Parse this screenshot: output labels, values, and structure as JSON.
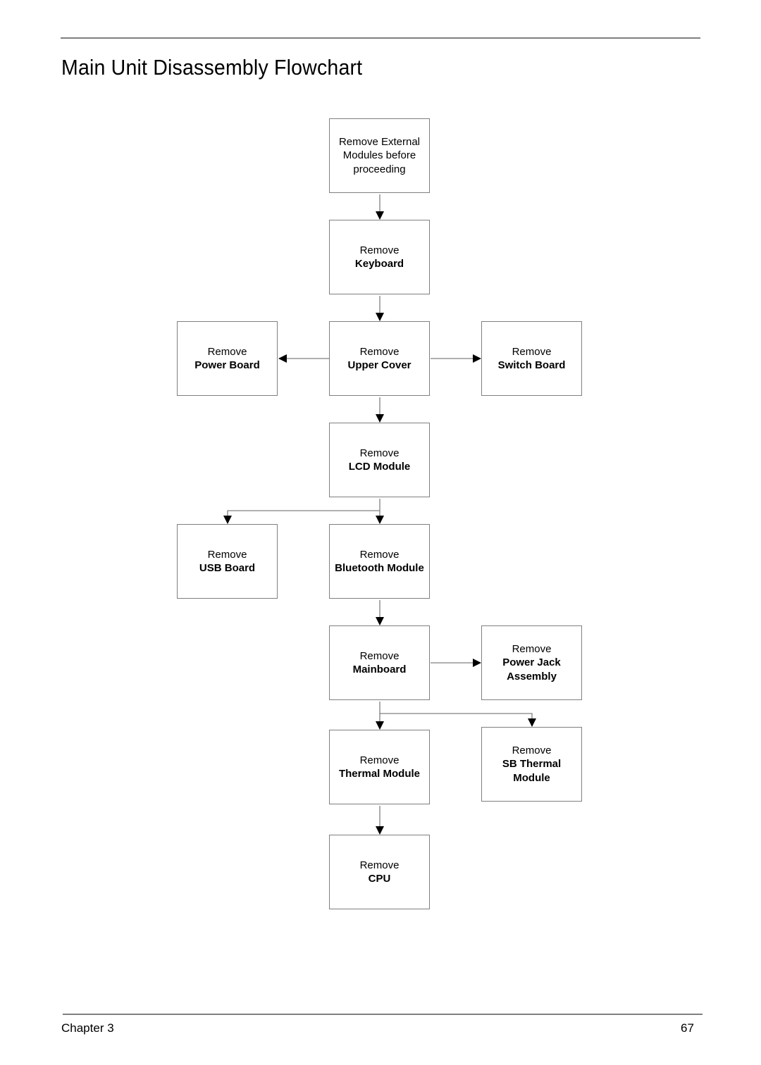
{
  "page": {
    "title": "Main Unit Disassembly Flowchart",
    "footer": {
      "chapter": "Chapter 3",
      "page_number": "67"
    }
  },
  "nodes": {
    "external": {
      "verb": "Remove External Modules before proceeding",
      "obj": ""
    },
    "keyboard": {
      "verb": "Remove",
      "obj": "Keyboard"
    },
    "power_board": {
      "verb": "Remove",
      "obj": "Power Board"
    },
    "upper_cover": {
      "verb": "Remove",
      "obj": "Upper Cover"
    },
    "switch_board": {
      "verb": "Remove",
      "obj": "Switch Board"
    },
    "lcd_module": {
      "verb": "Remove",
      "obj": "LCD Module"
    },
    "usb_board": {
      "verb": "Remove",
      "obj": "USB Board"
    },
    "bluetooth_module": {
      "verb": "Remove",
      "obj": "Bluetooth Module"
    },
    "mainboard": {
      "verb": "Remove",
      "obj": "Mainboard"
    },
    "power_jack": {
      "verb": "Remove",
      "obj": "Power Jack Assembly"
    },
    "thermal_module": {
      "verb": "Remove",
      "obj": "Thermal Module"
    },
    "sb_thermal": {
      "verb": "Remove",
      "obj": "SB Thermal Module"
    },
    "cpu": {
      "verb": "Remove",
      "obj": "CPU"
    }
  },
  "edges": [
    [
      "external",
      "keyboard"
    ],
    [
      "keyboard",
      "upper_cover"
    ],
    [
      "upper_cover",
      "power_board"
    ],
    [
      "upper_cover",
      "switch_board"
    ],
    [
      "upper_cover",
      "lcd_module"
    ],
    [
      "lcd_module",
      "usb_board"
    ],
    [
      "lcd_module",
      "bluetooth_module"
    ],
    [
      "bluetooth_module",
      "mainboard"
    ],
    [
      "mainboard",
      "power_jack"
    ],
    [
      "mainboard",
      "thermal_module"
    ],
    [
      "mainboard",
      "sb_thermal"
    ],
    [
      "thermal_module",
      "cpu"
    ]
  ]
}
